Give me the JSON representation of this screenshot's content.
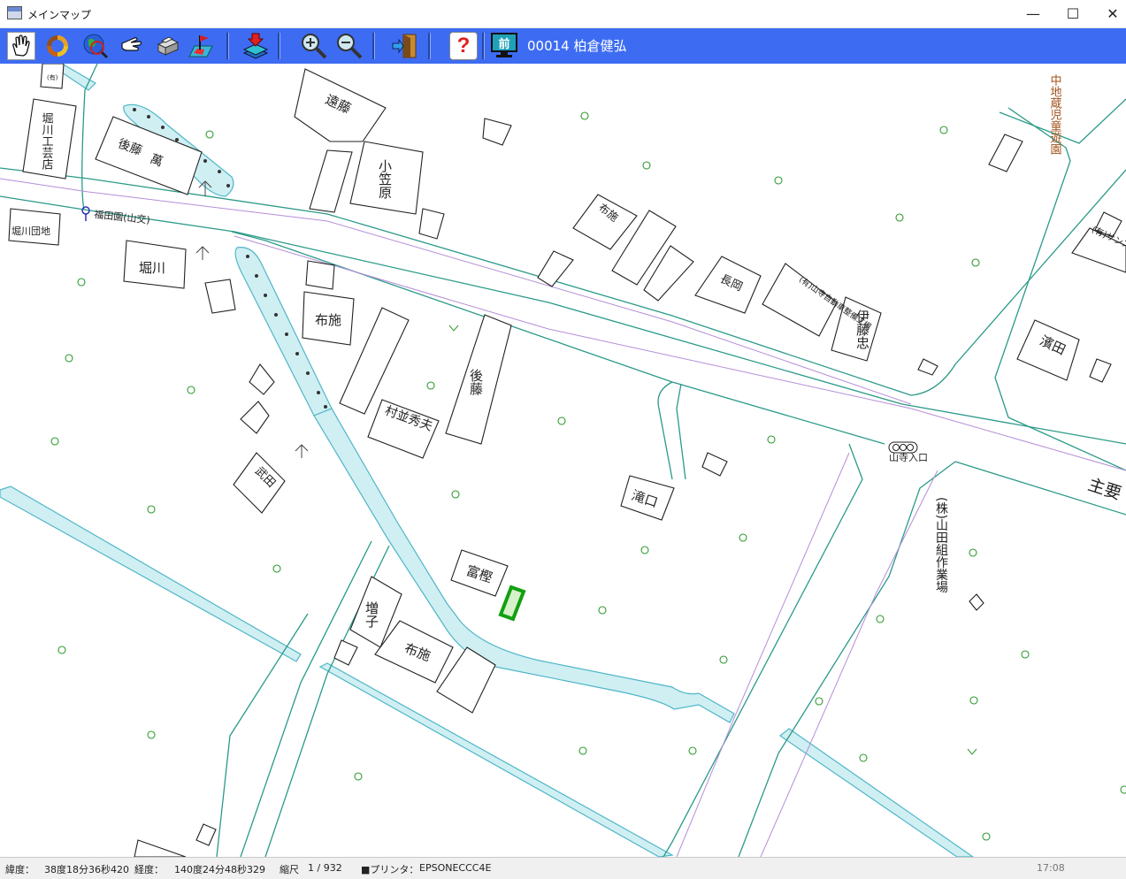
{
  "window": {
    "title": "メインマップ",
    "minimize_glyph": "—",
    "maximize_glyph": "☐",
    "close_glyph": "✕"
  },
  "toolbar": {
    "buttons": [
      {
        "name": "pan-hand-icon"
      },
      {
        "name": "refresh-cycle-icon"
      },
      {
        "name": "globe-search-icon"
      },
      {
        "name": "pointer-hand-icon"
      },
      {
        "name": "printer-icon"
      },
      {
        "name": "map-flag-icon"
      },
      {
        "name": "layer-download-icon"
      },
      {
        "name": "zoom-in-icon"
      },
      {
        "name": "zoom-out-icon"
      },
      {
        "name": "exit-door-icon"
      },
      {
        "name": "help-icon",
        "label": "?"
      },
      {
        "name": "previous-monitor-icon",
        "label": "前"
      }
    ],
    "current_record": "00014 柏倉健弘"
  },
  "map": {
    "labels": {
      "endo": "遠藤",
      "horikawa_kougei": "堀川工芸店",
      "goto_yorozu_a": "後藤",
      "goto_yorozu_b": "萬",
      "ogasawara": "小笠原",
      "nakaji_park": "中地蔵児童遊園",
      "bus_stop": "福田園(山交)",
      "horikawa_danchi": "堀川団地",
      "horikawa": "堀川",
      "fuse_1": "布施",
      "fuse_2": "布施",
      "fuse_3": "布施",
      "goto_2": "後藤",
      "muranami": "村並秀夫",
      "nagaoka": "長岡",
      "yamadera_car": "(有)山寺自動車整備工場",
      "ito_tada": "伊藤忠",
      "hamada": "濱田",
      "yamadera_shokai": "(有)サンス商会山形",
      "intersection": "山寺入口",
      "main_road": "主要",
      "yamada_sagyo": "(株)山田組作業場",
      "takiguchi": "滝口",
      "tomikashi": "富樫",
      "masuko": "増子",
      "takeda": "武田",
      "small_label": "(有)"
    }
  },
  "status": {
    "lat_label": "緯度：",
    "lat_value": "38度18分36秒420",
    "lon_label": "経度：",
    "lon_value": "140度24分48秒329",
    "scale_label": "縮尺",
    "scale_value": "1 / 932",
    "printer_label": "■プリンタ：",
    "printer_value": "EPSONECCC4E",
    "time": "17:08"
  },
  "colors": {
    "toolbar_bg": "#3d6cf2",
    "road_line": "#2a9a88",
    "boundary_line": "#b58ed8",
    "water_fill": "#cfeff2",
    "water_edge": "#4fb6c8",
    "tree_symbol": "#2f9a2f",
    "selected_parcel": "#12a012",
    "park_label": "#a0521a"
  }
}
